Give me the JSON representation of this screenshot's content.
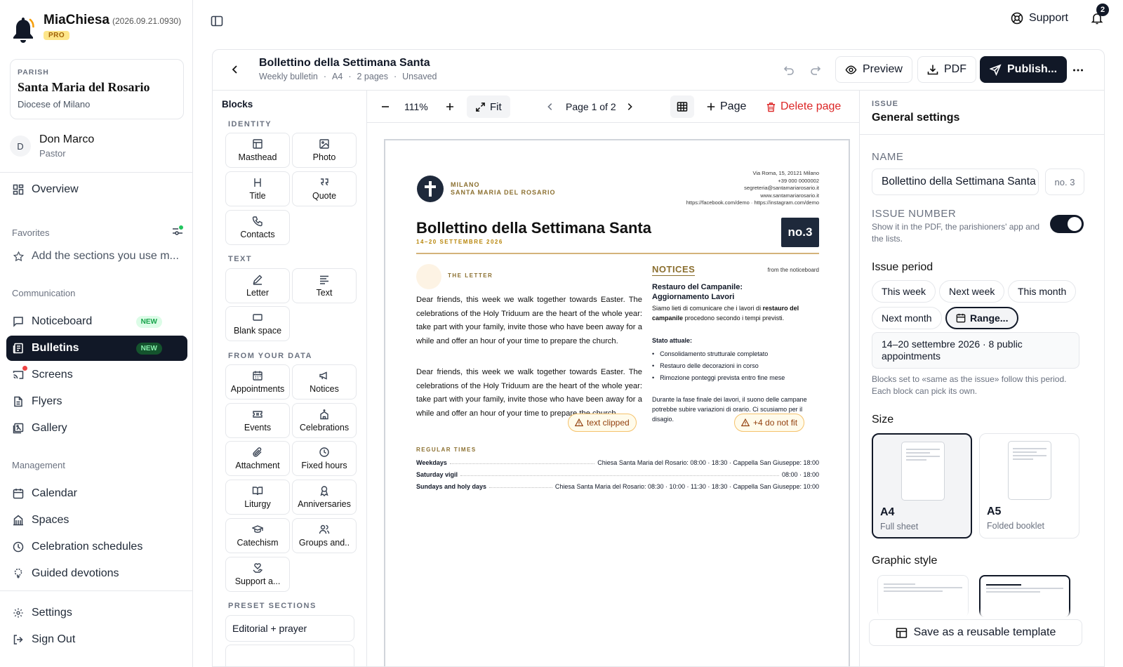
{
  "app": {
    "name": "MiaChiesa",
    "version": "(2026.09.21.0930)",
    "tier": "PRO"
  },
  "parish": {
    "label": "PARISH",
    "name": "Santa Maria del Rosario",
    "diocese": "Diocese of Milano"
  },
  "user": {
    "initial": "D",
    "name": "Don Marco",
    "role": "Pastor"
  },
  "nav": {
    "overview": "Overview",
    "favorites_label": "Favorites",
    "favorites_hint": "Add the sections you use m...",
    "communication_label": "Communication",
    "noticeboard": "Noticeboard",
    "bulletins": "Bulletins",
    "new_badge": "NEW",
    "screens": "Screens",
    "flyers": "Flyers",
    "gallery": "Gallery",
    "management_label": "Management",
    "calendar": "Calendar",
    "spaces": "Spaces",
    "celebration_schedules": "Celebration schedules",
    "guided_devotions": "Guided devotions",
    "settings": "Settings",
    "sign_out": "Sign Out"
  },
  "topbar": {
    "support": "Support",
    "notifications": "2"
  },
  "doc": {
    "title": "Bollettino della Settimana Santa",
    "meta": [
      "Weekly bulletin",
      "A4",
      "2 pages",
      "Unsaved"
    ]
  },
  "actions": {
    "preview": "Preview",
    "pdf": "PDF",
    "publish": "Publish..."
  },
  "blocks": {
    "title": "Blocks",
    "identity_label": "IDENTITY",
    "identity": [
      "Masthead",
      "Photo",
      "Title",
      "Quote",
      "Contacts"
    ],
    "text_label": "TEXT",
    "text": [
      "Letter",
      "Text",
      "Blank space"
    ],
    "data_label": "FROM YOUR DATA",
    "data": [
      "Appointments",
      "Notices",
      "Events",
      "Celebrations",
      "Attachment",
      "Fixed hours",
      "Liturgy",
      "Anniversaries",
      "Catechism",
      "Groups and..",
      "Support a..."
    ],
    "preset_label": "PRESET SECTIONS",
    "presets": [
      "Editorial + prayer"
    ]
  },
  "canvas": {
    "zoom": "111%",
    "fit": "Fit",
    "page_indicator": "Page 1 of 2",
    "add_page": "Page",
    "delete_page": "Delete page"
  },
  "bulletin": {
    "city": "MILANO",
    "parish": "SANTA MARIA DEL ROSARIO",
    "contacts": [
      "Via Roma, 15, 20121 Milano",
      "+39 000 0000002",
      "segreteria@santamariarosario.it",
      "www.santamariarosario.it",
      "https://facebook.com/demo · https://instagram.com/demo"
    ],
    "title": "Bollettino della Settimana Santa",
    "date": "14–20 SETTEMBRE 2026",
    "number": "no.3",
    "letter_label": "THE LETTER",
    "letter_paragraphs": [
      "Dear friends, this week we walk together towards Easter. The celebrations of the Holy Triduum are the heart of the whole year: take part with your family, invite those who have been away for a while and offer an hour of your time to prepare the church.",
      "Dear friends, this week we walk together towards Easter. The celebrations of the Holy Triduum are the heart of the whole year: take part with your family, invite those who have been away for a while and offer an hour of your time to prepare the church."
    ],
    "notices_label": "NOTICES",
    "notices_from": "from the noticeboard",
    "notice_title": "Restauro del Campanile: Aggiornamento Lavori",
    "notice_p1_a": "Siamo lieti di comunicare che i lavori di ",
    "notice_p1_b": "restauro del campanile",
    "notice_p1_c": " procedono secondo i tempi previsti.",
    "notice_status": "Stato attuale:",
    "notice_items": [
      "Consolidamento strutturale completato",
      "Restauro delle decorazioni in corso",
      "Rimozione ponteggi prevista entro fine mese"
    ],
    "notice_p2": "Durante la fase finale dei lavori, il suono delle campane potrebbe subire variazioni di orario. Ci scusiamo per il disagio.",
    "chip_clipped": "text clipped",
    "chip_overflow": "+4 do not fit",
    "regular_label": "REGULAR TIMES",
    "regular_rows": [
      {
        "k": "Weekdays",
        "v": "Chiesa Santa Maria del Rosario: 08:00 · 18:30 · Cappella San Giuseppe: 18:00"
      },
      {
        "k": "Saturday vigil",
        "v": "08:00 · 18:00"
      },
      {
        "k": "Sundays and holy days",
        "v": "Chiesa Santa Maria del Rosario: 08:30 · 10:00 · 11:30 · 18:30 · Cappella San Giuseppe: 10:00"
      }
    ]
  },
  "settings": {
    "section": "ISSUE",
    "title": "General settings",
    "name_label": "NAME",
    "name_value": "Bollettino della Settimana Santa",
    "no_value": "no. 3",
    "issue_number_label": "ISSUE NUMBER",
    "issue_number_help": "Show it in the PDF, the parishioners' app and the lists.",
    "issue_number_on": true,
    "period_label": "Issue period",
    "period_options": [
      "This week",
      "Next week",
      "This month",
      "Next month",
      "Range..."
    ],
    "period_selected": "Range...",
    "period_value": "14–20 settembre 2026 · 8 public appointments",
    "period_help": "Blocks set to «same as the issue» follow this period. Each block can pick its own.",
    "size_label": "Size",
    "sizes": [
      {
        "name": "A4",
        "desc": "Full sheet"
      },
      {
        "name": "A5",
        "desc": "Folded booklet"
      }
    ],
    "size_selected": "A4",
    "style_label": "Graphic style",
    "save_template": "Save as a reusable template"
  }
}
